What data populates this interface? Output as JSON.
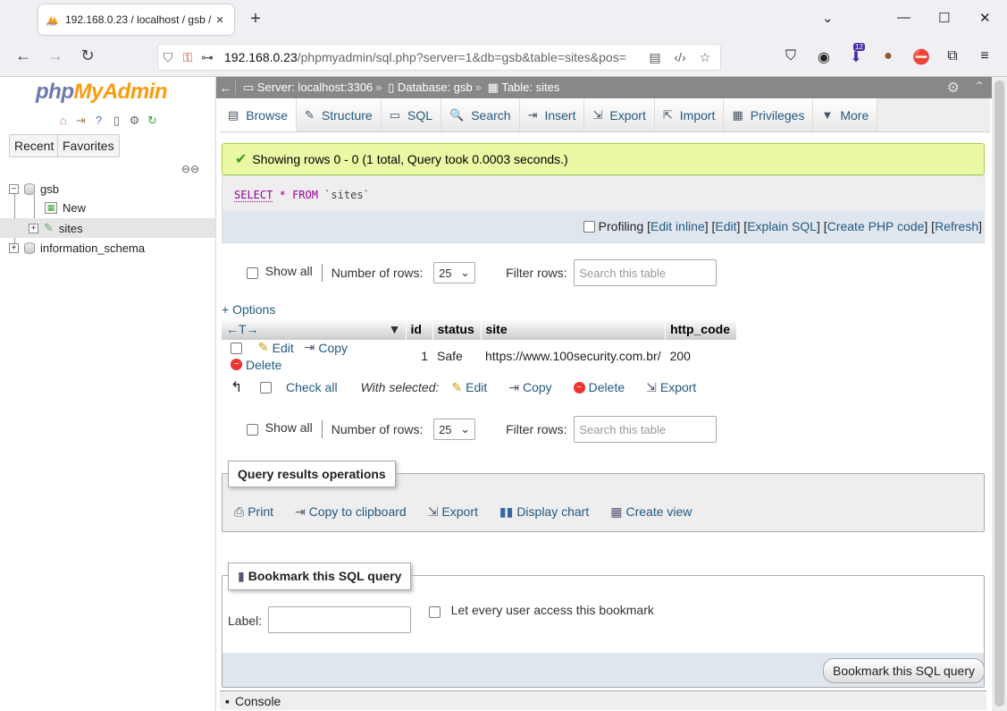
{
  "browser": {
    "tab_title": "192.168.0.23 / localhost / gsb / s",
    "tab_close": "×",
    "new_tab": "+",
    "url_host": "192.168.0.23",
    "url_path": "/phpmyadmin/sql.php?server=1&db=gsb&table=sites&pos=",
    "ext_badge": "12"
  },
  "sidebar": {
    "logo_php": "php",
    "logo_myadmin": "MyAdmin",
    "recent": "Recent",
    "favorites": "Favorites",
    "tree": {
      "db1": "gsb",
      "new": "New",
      "table": "sites",
      "db2": "information_schema"
    }
  },
  "topbar": {
    "server": "Server: localhost:3306",
    "database": "Database: gsb",
    "table": "Table: sites",
    "sep": "»"
  },
  "tabs": [
    {
      "label": "Browse",
      "icon": "▤"
    },
    {
      "label": "Structure",
      "icon": "✎"
    },
    {
      "label": "SQL",
      "icon": "▭"
    },
    {
      "label": "Search",
      "icon": "🔍"
    },
    {
      "label": "Insert",
      "icon": "⇥"
    },
    {
      "label": "Export",
      "icon": "⇲"
    },
    {
      "label": "Import",
      "icon": "⇱"
    },
    {
      "label": "Privileges",
      "icon": "▦"
    },
    {
      "label": "More",
      "icon": "▼"
    }
  ],
  "success_msg": "Showing rows 0 - 0 (1 total, Query took 0.0003 seconds.)",
  "sql": {
    "kw_select": "SELECT",
    "star": "*",
    "kw_from": "FROM",
    "table": "`sites`"
  },
  "sql_actions": {
    "profiling": "Profiling",
    "edit_inline": "Edit inline",
    "edit": "Edit",
    "explain": "Explain SQL",
    "php": "Create PHP code",
    "refresh": "Refresh"
  },
  "nav": {
    "show_all": "Show all",
    "rows_label": "Number of rows:",
    "rows_value": "25",
    "filter_label": "Filter rows:",
    "filter_placeholder": "Search this table"
  },
  "options_link": "+ Options",
  "grid": {
    "arrows": "←T→",
    "columns": [
      "id",
      "status",
      "site",
      "http_code"
    ],
    "row": {
      "edit": "Edit",
      "copy": "Copy",
      "delete": "Delete",
      "id": "1",
      "status": "Safe",
      "site": "https://www.100security.com.br/",
      "http_code": "200"
    }
  },
  "bulk": {
    "check_all": "Check all",
    "with_selected": "With selected:",
    "edit": "Edit",
    "copy": "Copy",
    "delete": "Delete",
    "export": "Export"
  },
  "ops": {
    "legend": "Query results operations",
    "print": "Print",
    "copy_clip": "Copy to clipboard",
    "export": "Export",
    "chart": "Display chart",
    "view": "Create view"
  },
  "bookmark": {
    "legend": "Bookmark this SQL query",
    "label": "Label:",
    "every_user": "Let every user access this bookmark",
    "button": "Bookmark this SQL query"
  },
  "console": "Console"
}
